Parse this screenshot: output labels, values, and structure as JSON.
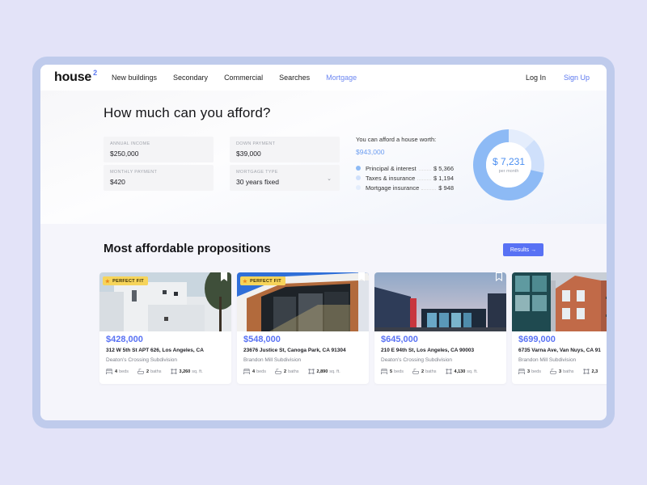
{
  "nav": {
    "logo": "house",
    "logo_sup": "2",
    "links": [
      {
        "label": "New buildings",
        "active": false
      },
      {
        "label": "Secondary",
        "active": false
      },
      {
        "label": "Commercial",
        "active": false
      },
      {
        "label": "Searches",
        "active": false
      },
      {
        "label": "Mortgage",
        "active": true
      }
    ],
    "login": "Log In",
    "signup": "Sign Up"
  },
  "calculator": {
    "title": "How much can you afford?",
    "fields": {
      "annual_income": {
        "label": "ANNUAL INCOME",
        "value": "$250,000"
      },
      "down_payment": {
        "label": "DOWN PAYMENT",
        "value": "$39,000"
      },
      "monthly_payment": {
        "label": "MONTHLY PAYMENT",
        "value": "$420"
      },
      "mortgage_type": {
        "label": "MORTGAGE TYPE",
        "value": "30 years fixed"
      }
    },
    "afford_label": "You can afford a house worth:",
    "afford_amount": "$943,000",
    "breakdown": [
      {
        "name": "Principal & interest",
        "amount": "$ 5,366",
        "value": 5366,
        "color": "#8dbaf5"
      },
      {
        "name": "Taxes & insurance",
        "amount": "$ 1,194",
        "value": 1194,
        "color": "#cfe0fb"
      },
      {
        "name": "Mortgage insurance",
        "amount": "$ 948",
        "value": 948,
        "color": "#e4edfc"
      }
    ],
    "total": "$ 7,231",
    "total_caption": "per month"
  },
  "propositions": {
    "title": "Most affordable propositions",
    "results_button": "Results →",
    "cards": [
      {
        "price": "$428,000",
        "address": "312 W 5th St APT 626, Los Angeles, CA",
        "subdivision": "Deaton’s Crossing Subdivision",
        "beds": "4",
        "baths": "2",
        "sqft": "3,260",
        "badge": "PERFECT FIT",
        "bookmarked": true
      },
      {
        "price": "$548,000",
        "address": "23676 Justice St, Canoga Park, CA 91304",
        "subdivision": "Brandon Mill Subdivision",
        "beds": "4",
        "baths": "2",
        "sqft": "2,890",
        "badge": "PERFECT FIT",
        "bookmarked": true
      },
      {
        "price": "$645,000",
        "address": "210 E 94th St, Los Angeles, CA 90003",
        "subdivision": "Deaton’s Crossing Subdivision",
        "beds": "5",
        "baths": "2",
        "sqft": "4,130",
        "badge": null,
        "bookmarked": false
      },
      {
        "price": "$699,000",
        "address": "6735 Varna Ave, Van Nuys, CA 91",
        "subdivision": "Brandon Mill Subdivision",
        "beds": "3",
        "baths": "3",
        "sqft": "2,3",
        "badge": null,
        "bookmarked": false
      }
    ],
    "beds_label": "beds",
    "baths_label": "baths",
    "sqft_label": "sq. ft.",
    "badge_star": "★"
  }
}
